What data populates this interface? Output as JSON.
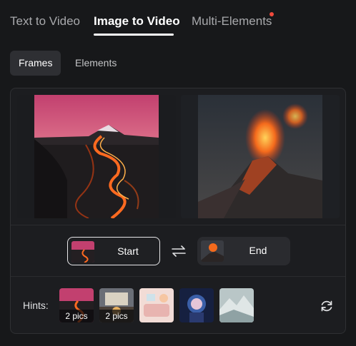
{
  "tabs": [
    {
      "label": "Text to Video",
      "active": false
    },
    {
      "label": "Image to Video",
      "active": true
    },
    {
      "label": "Multi-Elements",
      "active": false,
      "has_notification_dot": true
    }
  ],
  "subtabs": [
    {
      "label": "Frames",
      "active": true
    },
    {
      "label": "Elements",
      "active": false
    }
  ],
  "frames": {
    "start_label": "Start",
    "end_label": "End",
    "swap_icon": "swap-arrows-icon"
  },
  "hints": {
    "label": "Hints:",
    "items": [
      {
        "name": "volcano-lava",
        "badge": "2 pics"
      },
      {
        "name": "cafe-scene",
        "badge": "2 pics"
      },
      {
        "name": "pastel-room",
        "badge": ""
      },
      {
        "name": "astronaut",
        "badge": ""
      },
      {
        "name": "snowy-mountain",
        "badge": ""
      }
    ],
    "refresh_icon": "refresh-icon"
  },
  "colors": {
    "background": "#17181a",
    "panel": "#1c1d20",
    "accent_dot": "#f04a3c",
    "text_muted": "#a8a9ac"
  }
}
